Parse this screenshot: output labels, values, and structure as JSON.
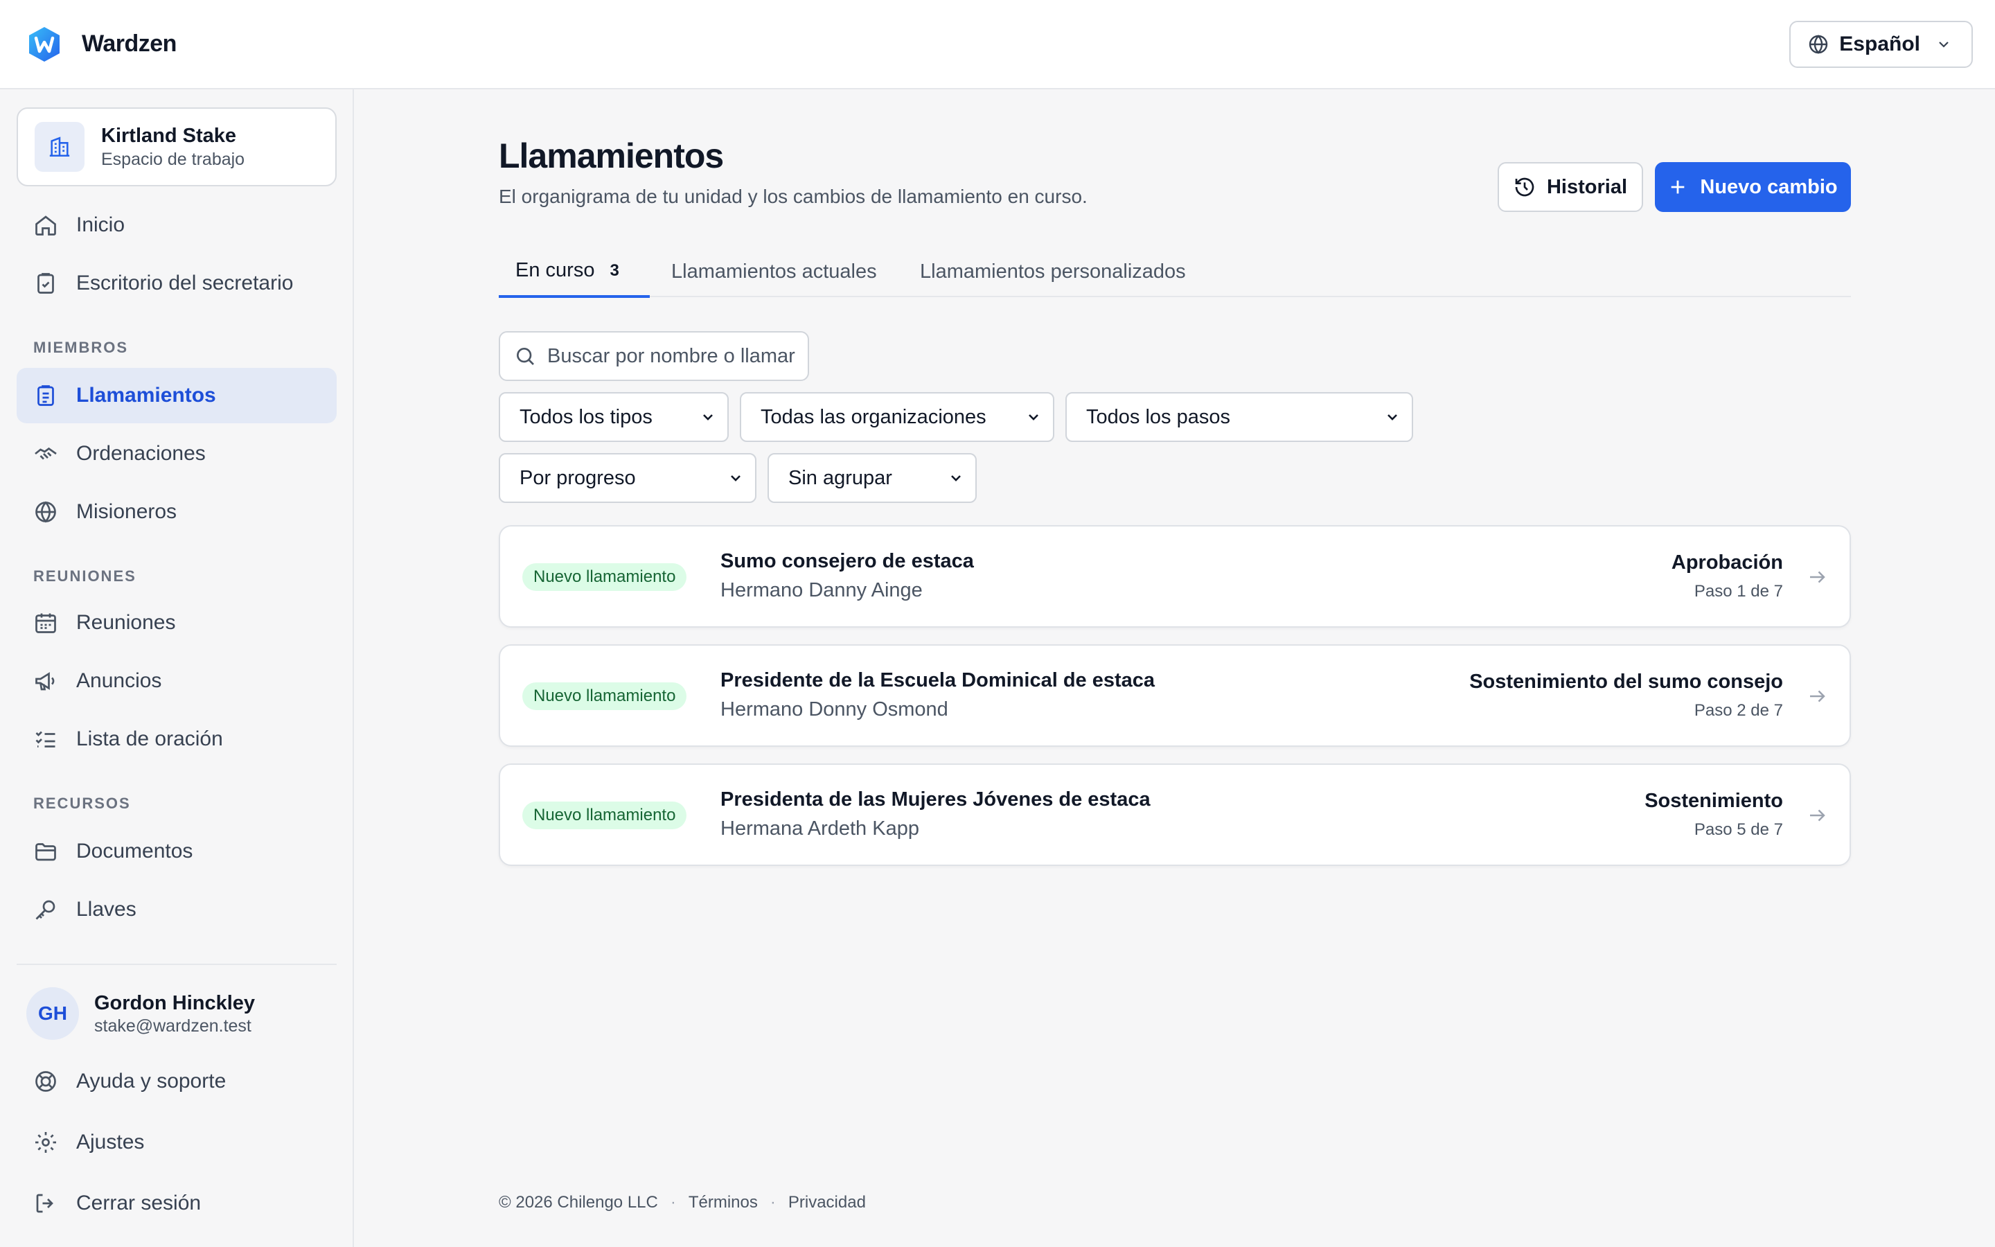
{
  "app": {
    "name": "Wardzen"
  },
  "language": {
    "label": "Español"
  },
  "workspace": {
    "title": "Kirtland Stake",
    "subtitle": "Espacio de trabajo"
  },
  "nav": {
    "top": [
      {
        "label": "Inicio",
        "icon": "home-icon"
      },
      {
        "label": "Escritorio del secretario",
        "icon": "clipboard-check-icon"
      }
    ],
    "sections": [
      {
        "label": "MIEMBROS",
        "items": [
          {
            "label": "Llamamientos",
            "icon": "clipboard-list-icon",
            "active": true
          },
          {
            "label": "Ordenaciones",
            "icon": "handshake-icon"
          },
          {
            "label": "Misioneros",
            "icon": "globe-icon"
          }
        ]
      },
      {
        "label": "REUNIONES",
        "items": [
          {
            "label": "Reuniones",
            "icon": "calendar-icon"
          },
          {
            "label": "Anuncios",
            "icon": "megaphone-icon"
          },
          {
            "label": "Lista de oración",
            "icon": "list-check-icon"
          }
        ]
      },
      {
        "label": "RECURSOS",
        "items": [
          {
            "label": "Documentos",
            "icon": "folder-icon"
          },
          {
            "label": "Llaves",
            "icon": "key-icon"
          }
        ]
      }
    ]
  },
  "user": {
    "initials": "GH",
    "name": "Gordon Hinckley",
    "email": "stake@wardzen.test"
  },
  "bottom_nav": [
    {
      "label": "Ayuda y soporte",
      "icon": "lifebuoy-icon"
    },
    {
      "label": "Ajustes",
      "icon": "gear-icon"
    },
    {
      "label": "Cerrar sesión",
      "icon": "logout-icon"
    }
  ],
  "page": {
    "title": "Llamamientos",
    "subtitle": "El organigrama de tu unidad y los cambios de llamamiento en curso.",
    "history_label": "Historial",
    "new_label": "Nuevo cambio"
  },
  "tabs": [
    {
      "label": "En curso",
      "count": "3",
      "active": true
    },
    {
      "label": "Llamamientos actuales"
    },
    {
      "label": "Llamamientos personalizados"
    }
  ],
  "search": {
    "placeholder": "Buscar por nombre o llamar"
  },
  "filters": {
    "type": "Todos los tipos",
    "organization": "Todas las organizaciones",
    "step": "Todos los pasos",
    "sort": "Por progreso",
    "group": "Sin agrupar"
  },
  "changes": [
    {
      "badge": "Nuevo llamamiento",
      "title": "Sumo consejero de estaca",
      "person": "Hermano Danny Ainge",
      "step": "Aprobación",
      "progress": "Paso 1 de 7"
    },
    {
      "badge": "Nuevo llamamiento",
      "title": "Presidente de la Escuela Dominical de estaca",
      "person": "Hermano Donny Osmond",
      "step": "Sostenimiento del sumo consejo",
      "progress": "Paso 2 de 7"
    },
    {
      "badge": "Nuevo llamamiento",
      "title": "Presidenta de las Mujeres Jóvenes de estaca",
      "person": "Hermana Ardeth Kapp",
      "step": "Sostenimiento",
      "progress": "Paso 5 de 7"
    }
  ],
  "footer": {
    "copyright": "© 2026 Chilengo LLC",
    "terms": "Términos",
    "privacy": "Privacidad"
  },
  "colors": {
    "accent": "#2563eb",
    "badge_bg": "#dcfce7",
    "badge_text": "#166534"
  }
}
